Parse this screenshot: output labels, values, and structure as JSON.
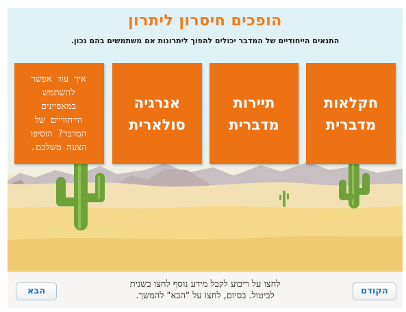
{
  "title": "הופכים חיסרון ליתרון",
  "subtitle": "התנאים הייחודיים של המדבר יכולים להפוך ליתרונות אם משתמשים בהם נכון.",
  "cards": [
    {
      "label": "חקלאות\nמדברית"
    },
    {
      "label": "תיירות\nמדברית"
    },
    {
      "label": "אנרגיה\nסולארית"
    },
    {
      "label": "איך עוד אפשר\nלהשתמש\nבמאפיינים\nהייחודיים של\nהמדבר? הוסיפו\nהצעה משלכם."
    }
  ],
  "footer": {
    "instructions": "לחצו על ריבוע לקבל מידע נוסף לחצו בשנית\nלביטול. בסיום, לחצו על \"הבא\" להמשך.",
    "prev_label": "הקודם",
    "next_label": "הבא"
  },
  "colors": {
    "accent": "#ee7d1c",
    "card": "#ec7214",
    "button_text": "#1e78c0"
  },
  "icons": [
    "cactus-icon"
  ]
}
